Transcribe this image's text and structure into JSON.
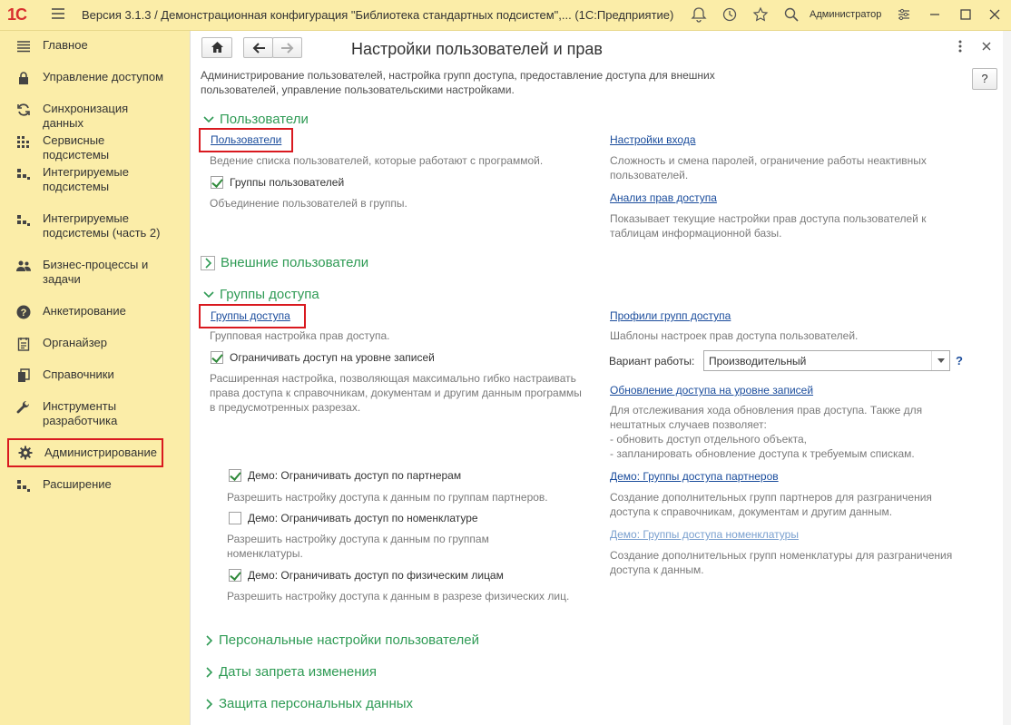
{
  "titlebar": {
    "logo": "1С",
    "title": "Версия 3.1.3 / Демонстрационная конфигурация \"Библиотека стандартных подсистем\",...  (1С:Предприятие)",
    "user": "Администратор"
  },
  "sidebar": {
    "items": [
      {
        "label": "Главное",
        "icon": "menu-lines-icon"
      },
      {
        "label": "Управление доступом",
        "icon": "lock-icon"
      },
      {
        "label": "Синхронизация данных",
        "icon": "sync-icon"
      },
      {
        "label": "Сервисные подсистемы",
        "icon": "grid-dots-icon"
      },
      {
        "label": "Интегрируемые подсистемы",
        "icon": "blocks-icon"
      },
      {
        "label": "Интегрируемые подсистемы (часть 2)",
        "icon": "blocks-icon"
      },
      {
        "label": "Бизнес-процессы и задачи",
        "icon": "users-icon"
      },
      {
        "label": "Анкетирование",
        "icon": "question-icon"
      },
      {
        "label": "Органайзер",
        "icon": "organizer-icon"
      },
      {
        "label": "Справочники",
        "icon": "books-icon"
      },
      {
        "label": "Инструменты разработчика",
        "icon": "wrench-icon"
      },
      {
        "label": "Администрирование",
        "icon": "gear-icon"
      },
      {
        "label": "Расширение",
        "icon": "extension-icon"
      }
    ],
    "active_index": 11
  },
  "page": {
    "title": "Настройки пользователей и прав",
    "description": "Администрирование пользователей, настройка групп доступа, предоставление доступа для внешних пользователей, управление пользовательскими настройками.",
    "help": "?"
  },
  "users_section": {
    "title": "Пользователи",
    "users_link": "Пользователи",
    "users_desc": "Ведение списка пользователей, которые работают с программой.",
    "groups_checkbox": "Группы пользователей",
    "groups_checked": true,
    "groups_desc": "Объединение пользователей в группы.",
    "login_link": "Настройки входа",
    "login_desc": "Сложность и смена паролей, ограничение работы неактивных пользователей.",
    "rights_link": "Анализ прав доступа",
    "rights_desc": "Показывает текущие настройки прав доступа пользователей к таблицам информационной базы."
  },
  "external_section": {
    "title": "Внешние пользователи"
  },
  "access_section": {
    "title": "Группы доступа",
    "groups_link": "Группы доступа",
    "groups_desc": "Групповая настройка прав доступа.",
    "rls_checkbox": "Ограничивать доступ на уровне записей",
    "rls_checked": true,
    "rls_desc": "Расширенная настройка, позволяющая максимально гибко настраивать права доступа к справочникам, документам и другим данным программы в предусмотренных разрезах.",
    "profiles_link": "Профили групп доступа",
    "profiles_desc": "Шаблоны настроек прав доступа пользователей.",
    "mode_label": "Вариант работы:",
    "mode_value": "Производительный",
    "mode_help": "?",
    "update_link": "Обновление доступа на уровне записей",
    "update_desc_1": "Для отслеживания хода обновления прав доступа. Также для",
    "update_desc_2": "нештатных случаев позволяет:",
    "update_desc_3": "- обновить доступ отдельного объекта,",
    "update_desc_4": "- запланировать обновление доступа к требуемым спискам.",
    "demo_partners_cb": "Демо: Ограничивать доступ по партнерам",
    "demo_partners_checked": true,
    "demo_partners_desc": "Разрешить настройку доступа к данным по группам партнеров.",
    "demo_nom_cb": "Демо: Ограничивать доступ по номенклатуре",
    "demo_nom_checked": false,
    "demo_nom_desc": "Разрешить настройку доступа к данным по группам номенклатуры.",
    "demo_persons_cb": "Демо: Ограничивать доступ по физическим лицам",
    "demo_persons_checked": true,
    "demo_persons_desc": "Разрешить настройку доступа к данным в разрезе физических лиц.",
    "partner_groups_link": "Демо: Группы доступа партнеров",
    "partner_groups_desc": "Создание дополнительных групп партнеров для разграничения доступа к справочникам, документам и другим данным.",
    "nom_groups_link": "Демо: Группы доступа номенклатуры",
    "nom_groups_desc": "Создание дополнительных групп номенклатуры для разграничения доступа к данным."
  },
  "collapsed_sections": [
    "Персональные настройки пользователей",
    "Даты запрета изменения",
    "Защита персональных данных"
  ]
}
